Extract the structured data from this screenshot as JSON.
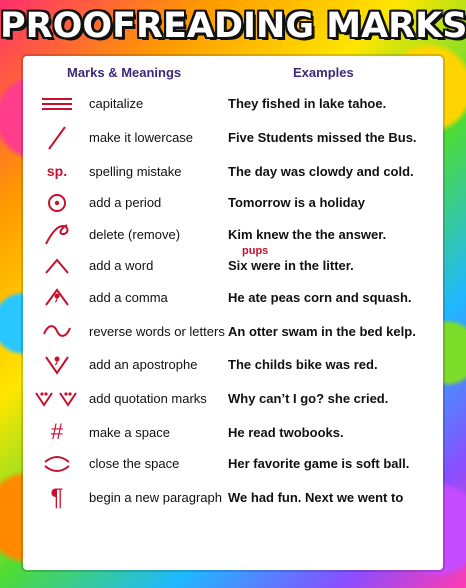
{
  "title": "PROOFREADING MARKS",
  "headers": {
    "marks": "Marks & Meanings",
    "examples": "Examples"
  },
  "rows": [
    {
      "meaning": "capitalize",
      "example": "They fished in lake tahoe.",
      "icon": "capitalize-mark-icon"
    },
    {
      "meaning": "make it lowercase",
      "example": "Five Students missed the Bus.",
      "icon": "lowercase-slash-icon"
    },
    {
      "meaning": "spelling mistake",
      "symbol": "sp.",
      "note": "sp.",
      "example": "The day was clowdy and cold.",
      "icon": "spelling-mark-icon"
    },
    {
      "meaning": "add a period",
      "example": "Tomorrow is a holiday",
      "icon": "period-mark-icon"
    },
    {
      "meaning": "delete (remove)",
      "example": "Kim knew the the answer.",
      "icon": "delete-mark-icon"
    },
    {
      "meaning": "add a word",
      "note": "pups",
      "example": "Six were in the litter.",
      "icon": "caret-icon"
    },
    {
      "meaning": "add a comma",
      "example": "He ate peas corn and squash.",
      "icon": "comma-caret-icon"
    },
    {
      "meaning": "reverse words or letters",
      "example": "An otter swam in the bed kelp.",
      "icon": "reverse-mark-icon"
    },
    {
      "meaning": "add an apostrophe",
      "example": "The childs bike was red.",
      "icon": "apostrophe-mark-icon"
    },
    {
      "meaning": "add quotation marks",
      "example": "Why can’t I go? she cried.",
      "icon": "quotation-mark-icon"
    },
    {
      "meaning": "make a space",
      "symbol": "#",
      "example": "He read twobooks.",
      "icon": "space-mark-icon"
    },
    {
      "meaning": "close the space",
      "example": "Her favorite game is soft ball.",
      "icon": "close-space-icon"
    },
    {
      "meaning": "begin a new paragraph",
      "symbol": "¶",
      "example": "We had fun. Next we went to",
      "icon": "paragraph-mark-icon"
    }
  ],
  "colors": {
    "mark_red": "#c8102e",
    "header_purple": "#3b2a7a"
  }
}
